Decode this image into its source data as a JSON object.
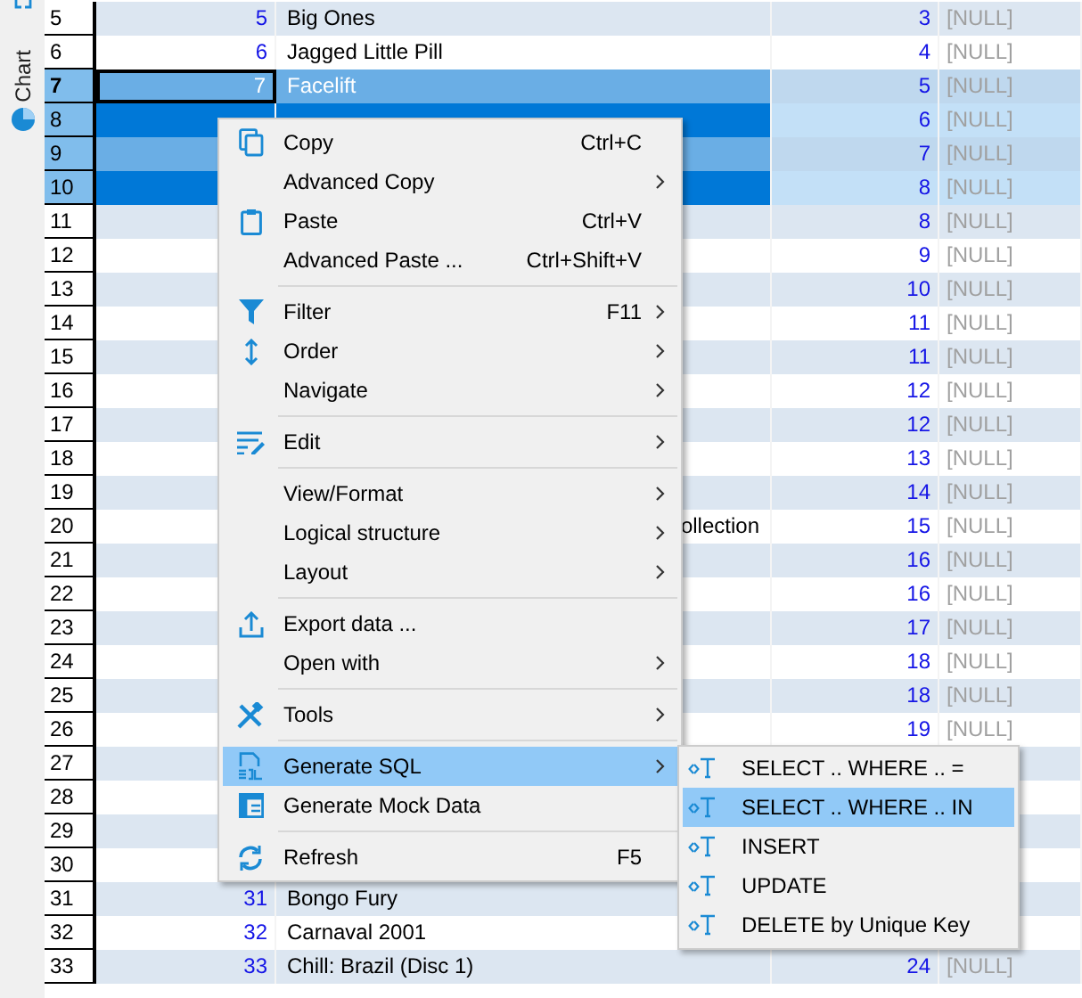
{
  "side_tabs": [
    {
      "label": "Chart"
    }
  ],
  "rows": [
    {
      "num": "5",
      "id": "5",
      "title": "Big Ones",
      "col3": "3",
      "col4": "[NULL]",
      "selected": false,
      "focused": false
    },
    {
      "num": "6",
      "id": "6",
      "title": "Jagged Little Pill",
      "col3": "4",
      "col4": "[NULL]",
      "selected": false,
      "focused": false
    },
    {
      "num": "7",
      "id": "7",
      "title": "Facelift",
      "col3": "5",
      "col4": "[NULL]",
      "selected": true,
      "focused": true
    },
    {
      "num": "8",
      "col3": "6",
      "col4": "[NULL]",
      "selected": true,
      "focused": false
    },
    {
      "num": "9",
      "col3": "7",
      "col4": "[NULL]",
      "selected": true,
      "focused": false
    },
    {
      "num": "10",
      "col3": "8",
      "col4": "[NULL]",
      "selected": true,
      "focused": false
    },
    {
      "num": "11",
      "col3": "8",
      "col4": "[NULL]",
      "selected": false,
      "focused": false
    },
    {
      "num": "12",
      "col3": "9",
      "col4": "[NULL]",
      "selected": false,
      "focused": false
    },
    {
      "num": "13",
      "col3": "10",
      "col4": "[NULL]",
      "selected": false,
      "focused": false
    },
    {
      "num": "14",
      "col3": "11",
      "col4": "[NULL]",
      "selected": false,
      "focused": false
    },
    {
      "num": "15",
      "col3": "11",
      "col4": "[NULL]",
      "selected": false,
      "focused": false
    },
    {
      "num": "16",
      "col3": "12",
      "col4": "[NULL]",
      "selected": false,
      "focused": false
    },
    {
      "num": "17",
      "col3": "12",
      "col4": "[NULL]",
      "selected": false,
      "focused": false
    },
    {
      "num": "18",
      "col3": "13",
      "col4": "[NULL]",
      "selected": false,
      "focused": false
    },
    {
      "num": "19",
      "col3": "14",
      "col4": "[NULL]",
      "selected": false,
      "focused": false
    },
    {
      "num": "20",
      "title_tail": "ollection",
      "col3": "15",
      "col4": "[NULL]",
      "selected": false,
      "focused": false
    },
    {
      "num": "21",
      "col3": "16",
      "col4": "[NULL]",
      "selected": false,
      "focused": false
    },
    {
      "num": "22",
      "col3": "16",
      "col4": "[NULL]",
      "selected": false,
      "focused": false
    },
    {
      "num": "23",
      "col3": "17",
      "col4": "[NULL]",
      "selected": false,
      "focused": false
    },
    {
      "num": "24",
      "col3": "18",
      "col4": "[NULL]",
      "selected": false,
      "focused": false
    },
    {
      "num": "25",
      "col3": "18",
      "col4": "[NULL]",
      "selected": false,
      "focused": false
    },
    {
      "num": "26",
      "col3": "19",
      "col4": "[NULL]",
      "selected": false,
      "focused": false
    },
    {
      "num": "27",
      "selected": false,
      "focused": false
    },
    {
      "num": "28",
      "selected": false,
      "focused": false
    },
    {
      "num": "29",
      "selected": false,
      "focused": false
    },
    {
      "num": "30",
      "selected": false,
      "focused": false
    },
    {
      "num": "31",
      "id": "31",
      "title": "Bongo Fury",
      "selected": false,
      "focused": false
    },
    {
      "num": "32",
      "id": "32",
      "title": "Carnaval 2001",
      "selected": false,
      "focused": false
    },
    {
      "num": "33",
      "id": "33",
      "title": "Chill: Brazil (Disc 1)",
      "col3": "24",
      "col4": "[NULL]",
      "selected": false,
      "focused": false
    }
  ],
  "context_menu": {
    "items": [
      {
        "kind": "item",
        "label": "Copy",
        "shortcut": "Ctrl+C",
        "submenu": false,
        "selected": false
      },
      {
        "kind": "item",
        "label": "Advanced Copy",
        "submenu": true,
        "selected": false
      },
      {
        "kind": "item",
        "label": "Paste",
        "shortcut": "Ctrl+V",
        "submenu": false,
        "selected": false
      },
      {
        "kind": "item",
        "label": "Advanced Paste ...",
        "shortcut": "Ctrl+Shift+V",
        "submenu": false,
        "selected": false
      },
      {
        "kind": "separator"
      },
      {
        "kind": "item",
        "label": "Filter",
        "shortcut": "F11",
        "submenu": true,
        "selected": false
      },
      {
        "kind": "item",
        "label": "Order",
        "submenu": true,
        "selected": false
      },
      {
        "kind": "item",
        "label": "Navigate",
        "submenu": true,
        "selected": false
      },
      {
        "kind": "separator"
      },
      {
        "kind": "item",
        "label": "Edit",
        "submenu": true,
        "selected": false
      },
      {
        "kind": "separator"
      },
      {
        "kind": "item",
        "label": "View/Format",
        "submenu": true,
        "selected": false
      },
      {
        "kind": "item",
        "label": "Logical structure",
        "submenu": true,
        "selected": false
      },
      {
        "kind": "item",
        "label": "Layout",
        "submenu": true,
        "selected": false
      },
      {
        "kind": "separator"
      },
      {
        "kind": "item",
        "label": "Export data ...",
        "submenu": false,
        "selected": false
      },
      {
        "kind": "item",
        "label": "Open with",
        "submenu": true,
        "selected": false
      },
      {
        "kind": "separator"
      },
      {
        "kind": "item",
        "label": "Tools",
        "submenu": true,
        "selected": false
      },
      {
        "kind": "separator"
      },
      {
        "kind": "item",
        "label": "Generate SQL",
        "submenu": true,
        "selected": true
      },
      {
        "kind": "item",
        "label": "Generate Mock Data",
        "submenu": false,
        "selected": false
      },
      {
        "kind": "separator"
      },
      {
        "kind": "item",
        "label": "Refresh",
        "shortcut": "F5",
        "submenu": false,
        "selected": false
      }
    ]
  },
  "submenu": {
    "items": [
      {
        "label": "SELECT .. WHERE .. =",
        "selected": false
      },
      {
        "label": "SELECT .. WHERE .. IN",
        "selected": true
      },
      {
        "label": "INSERT",
        "selected": false
      },
      {
        "label": "UPDATE",
        "selected": false
      },
      {
        "label": "DELETE by Unique Key",
        "selected": false
      }
    ]
  }
}
